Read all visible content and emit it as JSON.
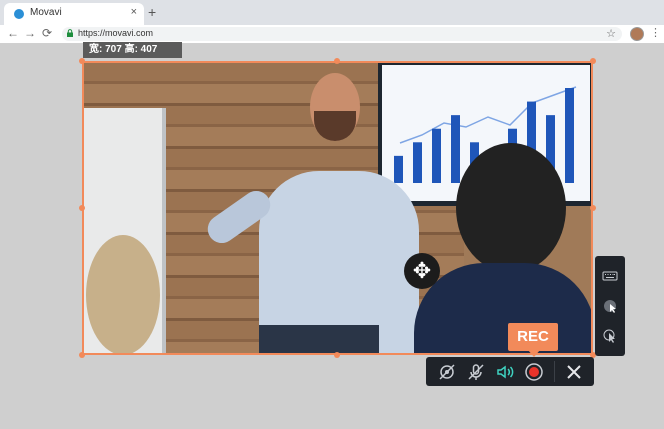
{
  "browser": {
    "tab_title": "Movavi",
    "tab_close": "×",
    "new_tab": "+",
    "url": "https://movavi.com",
    "back": "←",
    "forward": "→",
    "reload": "⟳",
    "star": "☆",
    "menu": "⋮"
  },
  "capture": {
    "size_label": "宽: 707  高: 407"
  },
  "recorder": {
    "rec_label": "REC",
    "move_glyph": "✥",
    "close_glyph": "✕"
  },
  "chart_data": {
    "type": "bar",
    "values": [
      2,
      3,
      4,
      5,
      3,
      2,
      4,
      6,
      5,
      7
    ]
  },
  "colors": {
    "accent": "#f28a5a",
    "panel": "#1f2329",
    "sound_on": "#3fd3c1",
    "record": "#e8332a"
  }
}
